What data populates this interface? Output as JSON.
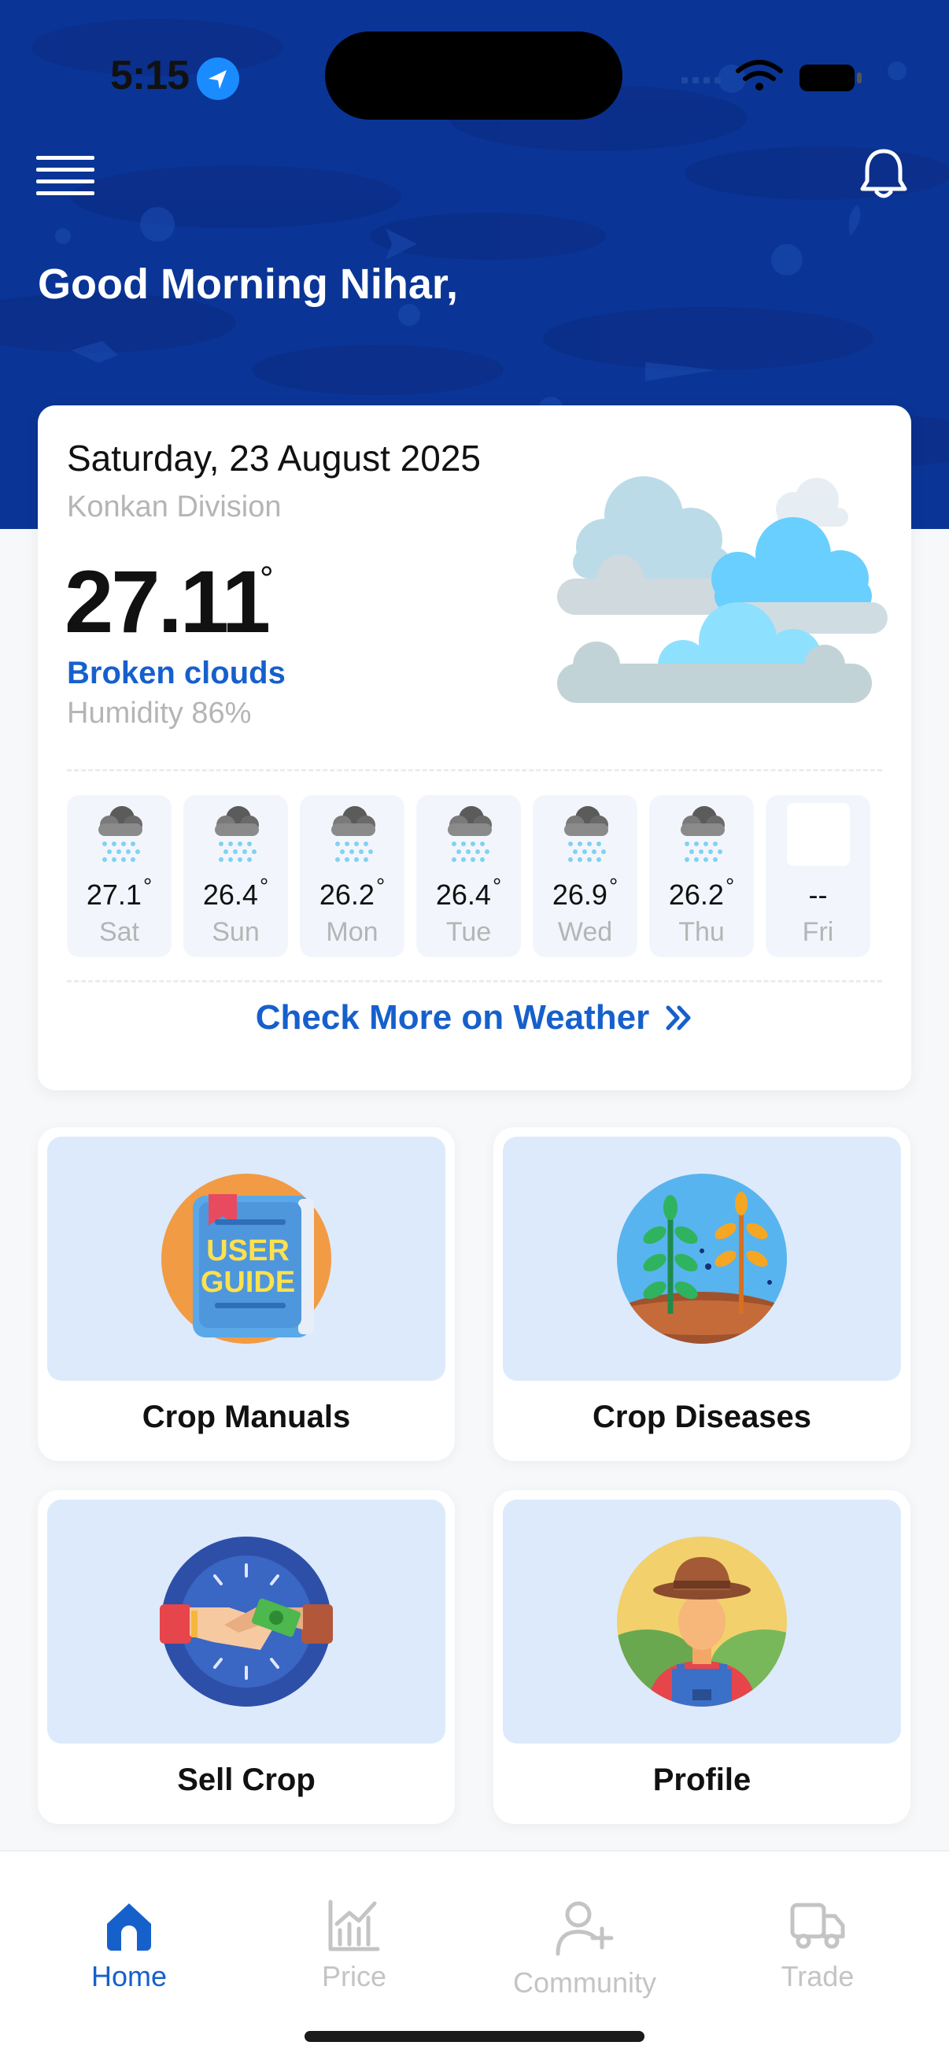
{
  "status_bar": {
    "time": "5:15"
  },
  "header": {
    "greeting": "Good Morning Nihar,"
  },
  "weather": {
    "date": "Saturday, 23 August 2025",
    "location": "Konkan Division",
    "temperature": "27.11",
    "degree_symbol": "°",
    "condition": "Broken clouds",
    "humidity": "Humidity 86%",
    "forecast": [
      {
        "day": "Sat",
        "temp": "27.1",
        "icon": "rain-cloud-icon"
      },
      {
        "day": "Sun",
        "temp": "26.4",
        "icon": "rain-cloud-icon"
      },
      {
        "day": "Mon",
        "temp": "26.2",
        "icon": "rain-cloud-icon"
      },
      {
        "day": "Tue",
        "temp": "26.4",
        "icon": "rain-cloud-icon"
      },
      {
        "day": "Wed",
        "temp": "26.9",
        "icon": "rain-cloud-icon"
      },
      {
        "day": "Thu",
        "temp": "26.2",
        "icon": "rain-cloud-icon"
      },
      {
        "day": "Fri",
        "temp": "--",
        "icon": "blank"
      }
    ],
    "check_more_label": "Check More on Weather"
  },
  "tiles": [
    {
      "label": "Crop Manuals",
      "icon": "user-guide-book-icon",
      "image_text_1": "USER",
      "image_text_2": "GUIDE"
    },
    {
      "label": "Crop Diseases",
      "icon": "plant-disease-icon"
    },
    {
      "label": "Sell Crop",
      "icon": "handshake-money-icon"
    },
    {
      "label": "Profile",
      "icon": "farmer-avatar-icon"
    }
  ],
  "nav": [
    {
      "label": "Home",
      "icon": "home-icon",
      "active": true
    },
    {
      "label": "Price",
      "icon": "chart-icon",
      "active": false
    },
    {
      "label": "Community",
      "icon": "add-user-icon",
      "active": false
    },
    {
      "label": "Trade",
      "icon": "truck-icon",
      "active": false
    }
  ],
  "colors": {
    "header_bg": "#0a3596",
    "accent": "#1660cc",
    "tile_bg": "#ddeafc",
    "muted": "#b5b5b5"
  }
}
